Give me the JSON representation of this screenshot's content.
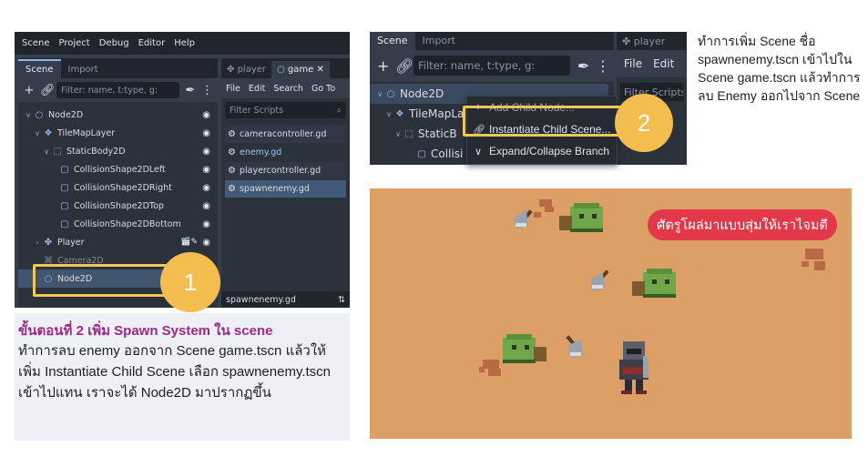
{
  "panel1": {
    "menubar": [
      "Scene",
      "Project",
      "Debug",
      "Editor",
      "Help"
    ],
    "scene_dock": {
      "tabs": [
        "Scene",
        "Import"
      ],
      "filter_placeholder": "Filter: name, t:type, g:",
      "nodes": [
        {
          "label": "Node2D",
          "icon": "circle-node-icon"
        },
        {
          "label": "TileMapLayer",
          "icon": "tilemap-icon"
        },
        {
          "label": "StaticBody2D",
          "icon": "staticbody-icon"
        },
        {
          "label": "CollisionShape2DLeft",
          "icon": "collision-shape-icon"
        },
        {
          "label": "CollisionShape2DRight",
          "icon": "collision-shape-icon"
        },
        {
          "label": "CollisionShape2DTop",
          "icon": "collision-shape-icon"
        },
        {
          "label": "CollisionShape2DBottom",
          "icon": "collision-shape-icon"
        },
        {
          "label": "Player",
          "icon": "character-body-icon"
        },
        {
          "label": "Camera2D",
          "icon": "camera-icon"
        },
        {
          "label": "Node2D",
          "icon": "circle-node-icon"
        }
      ]
    },
    "script_panel": {
      "tabs": [
        "player",
        "game"
      ],
      "menu": [
        "File",
        "Edit",
        "Search",
        "Go To"
      ],
      "filter_placeholder": "Filter Scripts",
      "scripts": [
        "cameracontroller.gd",
        "enemy.gd",
        "playercontroller.gd",
        "spawnenemy.gd"
      ],
      "bottom_label": "spawnenemy.gd"
    },
    "badge": "1"
  },
  "caption1": {
    "title": "ขั้นตอนที่ 2 เพิ่ม Spawn System ใน scene",
    "body": "ทำการลบ enemy ออกจาก Scene game.tscn แล้วให้เพิ่ม Instantiate Child Scene เลือก spawnenemy.tscn เข้าไปแทน เราจะได้ Node2D มาปรากฏขึ้น"
  },
  "panel2": {
    "tabs": [
      "Scene",
      "Import"
    ],
    "filter_placeholder": "Filter: name, t:type, g:",
    "nodes": [
      "Node2D",
      "TileMapLa",
      "StaticB",
      "Collisi"
    ],
    "right_tab": "player",
    "right_menu": [
      "File",
      "Edit"
    ],
    "right_filter": "Filter Scripts",
    "context_menu": [
      "Add Child Node...",
      "Instantiate Child Scene...",
      "Expand/Collapse Branch"
    ],
    "badge": "2"
  },
  "caption2": {
    "text": "ทำการเพิ่ม Scene ชื่อ spawnenemy.tscn เข้าไปใน Scene game.tscn แล้วทำการลบ Enemy ออกไปจาก Scene"
  },
  "game": {
    "bubble": "ศัตรูโผล่มาแบบสุ่มให้เราไจมตี",
    "ground_color": "#dc9f66",
    "bubble_color": "#e2384a"
  },
  "colors": {
    "highlight": "#f3c751",
    "badge": "#f4be4f",
    "caption_title": "#9b2a86",
    "editor_bg": "#363d4a"
  }
}
